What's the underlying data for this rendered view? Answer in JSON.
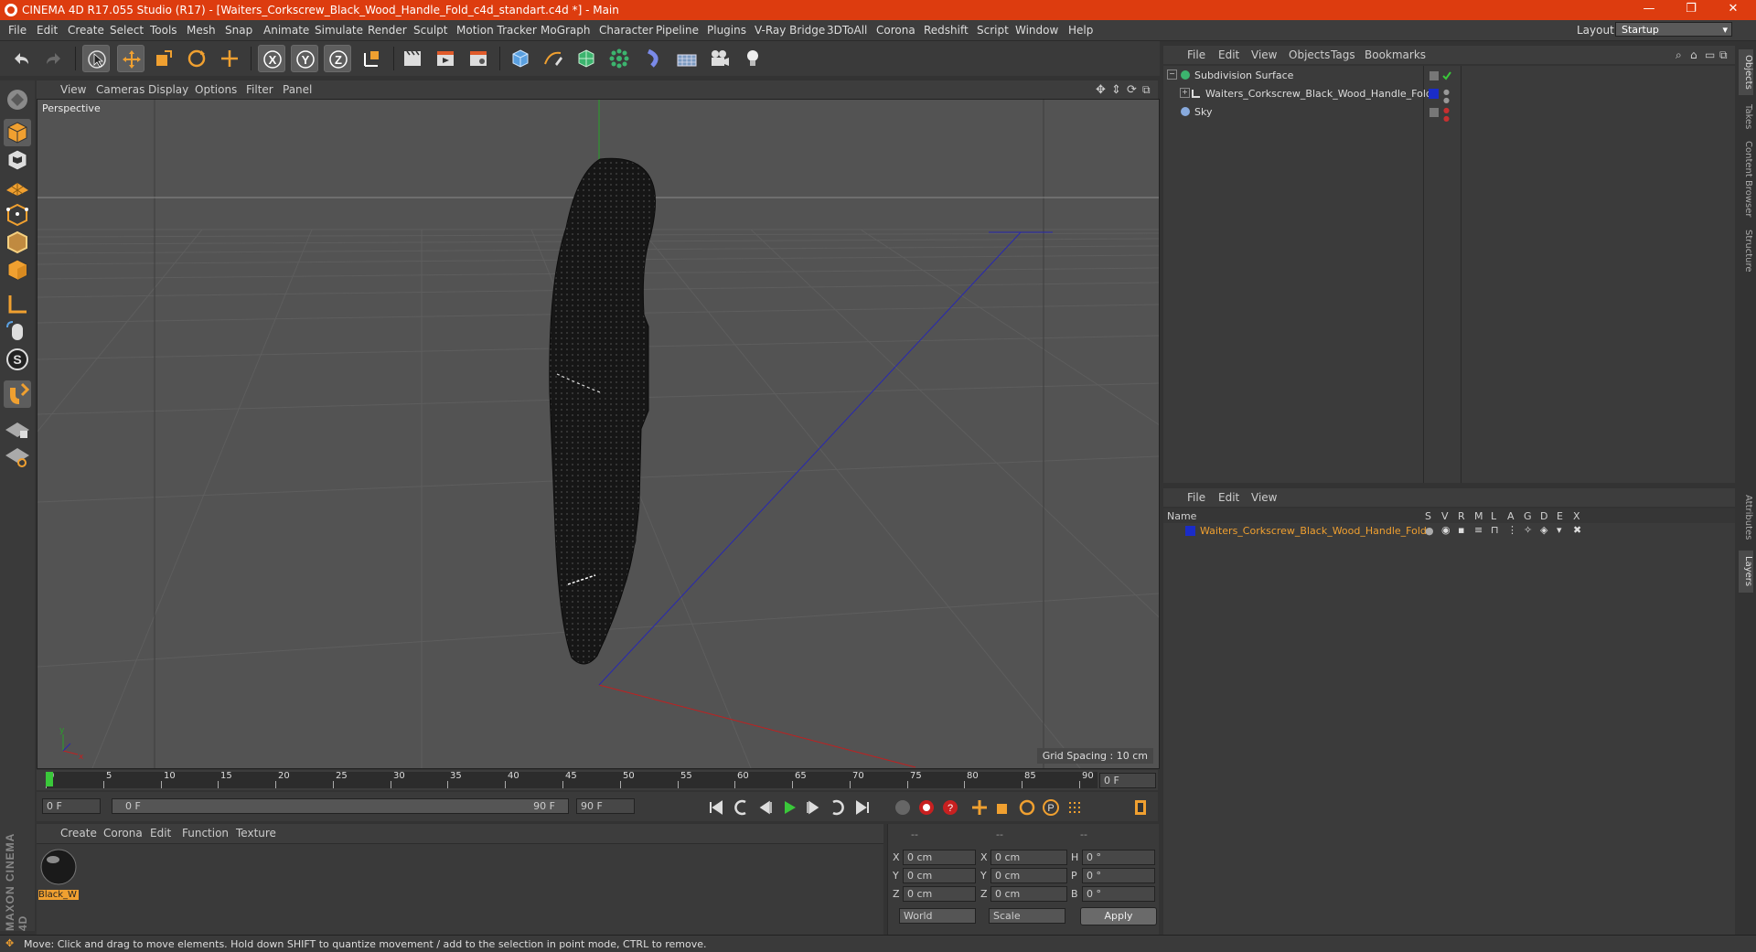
{
  "window": {
    "title": "CINEMA 4D R17.055 Studio (R17) - [Waiters_Corkscrew_Black_Wood_Handle_Fold_c4d_standart.c4d *] - Main"
  },
  "menu": [
    "File",
    "Edit",
    "Create",
    "Select",
    "Tools",
    "Mesh",
    "Snap",
    "Animate",
    "Simulate",
    "Render",
    "Sculpt",
    "Motion Tracker",
    "MoGraph",
    "Character",
    "Pipeline",
    "Plugins",
    "V-Ray Bridge",
    "3DToAll",
    "Corona",
    "Redshift",
    "Script",
    "Window",
    "Help"
  ],
  "layout": {
    "label": "Layout:",
    "value": "Startup"
  },
  "viewport": {
    "menu": [
      "View",
      "Cameras",
      "Display",
      "Options",
      "Filter",
      "Panel"
    ],
    "camera_label": "Perspective",
    "grid_spacing": "Grid Spacing : 10 cm"
  },
  "timeline": {
    "ticks": [
      "0",
      "5",
      "10",
      "15",
      "20",
      "25",
      "30",
      "35",
      "40",
      "45",
      "50",
      "55",
      "60",
      "65",
      "70",
      "75",
      "80",
      "85",
      "90"
    ],
    "current_frame": "0 F",
    "start_field": "0 F",
    "range_start": "0 F",
    "range_end": "90 F",
    "end_field": "90 F"
  },
  "materials": {
    "menu": [
      "Create",
      "Corona",
      "Edit",
      "Function",
      "Texture"
    ],
    "items": [
      {
        "label": "Black_W"
      }
    ]
  },
  "coordinates": {
    "headers": [
      "--",
      "--",
      "--"
    ],
    "rows": [
      {
        "a": "X",
        "av": "0 cm",
        "b": "X",
        "bv": "0 cm",
        "c": "H",
        "cv": "0 °"
      },
      {
        "a": "Y",
        "av": "0 cm",
        "b": "Y",
        "bv": "0 cm",
        "c": "P",
        "cv": "0 °"
      },
      {
        "a": "Z",
        "av": "0 cm",
        "b": "Z",
        "bv": "0 cm",
        "c": "B",
        "cv": "0 °"
      }
    ],
    "mode": "World",
    "type": "Scale",
    "apply": "Apply"
  },
  "objects": {
    "menu": [
      "File",
      "Edit",
      "View",
      "Objects",
      "Tags",
      "Bookmarks"
    ],
    "items": [
      {
        "name": "Subdivision Surface"
      },
      {
        "name": "Waiters_Corkscrew_Black_Wood_Handle_Fold"
      },
      {
        "name": "Sky"
      }
    ]
  },
  "layers": {
    "menu": [
      "File",
      "Edit",
      "View"
    ],
    "name_col": "Name",
    "flag_cols": [
      "S",
      "V",
      "R",
      "M",
      "L",
      "A",
      "G",
      "D",
      "E",
      "X"
    ],
    "items": [
      {
        "name": "Waiters_Corkscrew_Black_Wood_Handle_Fold"
      }
    ]
  },
  "right_tabs": [
    "Objects",
    "Takes",
    "Content Browser",
    "Structure",
    "Attributes",
    "Layers"
  ],
  "status": "Move: Click and drag to move elements. Hold down SHIFT to quantize movement / add to the selection in point mode, CTRL to remove.",
  "brand": "MAXON CINEMA 4D",
  "colors": {
    "titlebar": "#dd3c0f",
    "accent": "#f0a030",
    "layer_blue": "#1a2cc8"
  }
}
